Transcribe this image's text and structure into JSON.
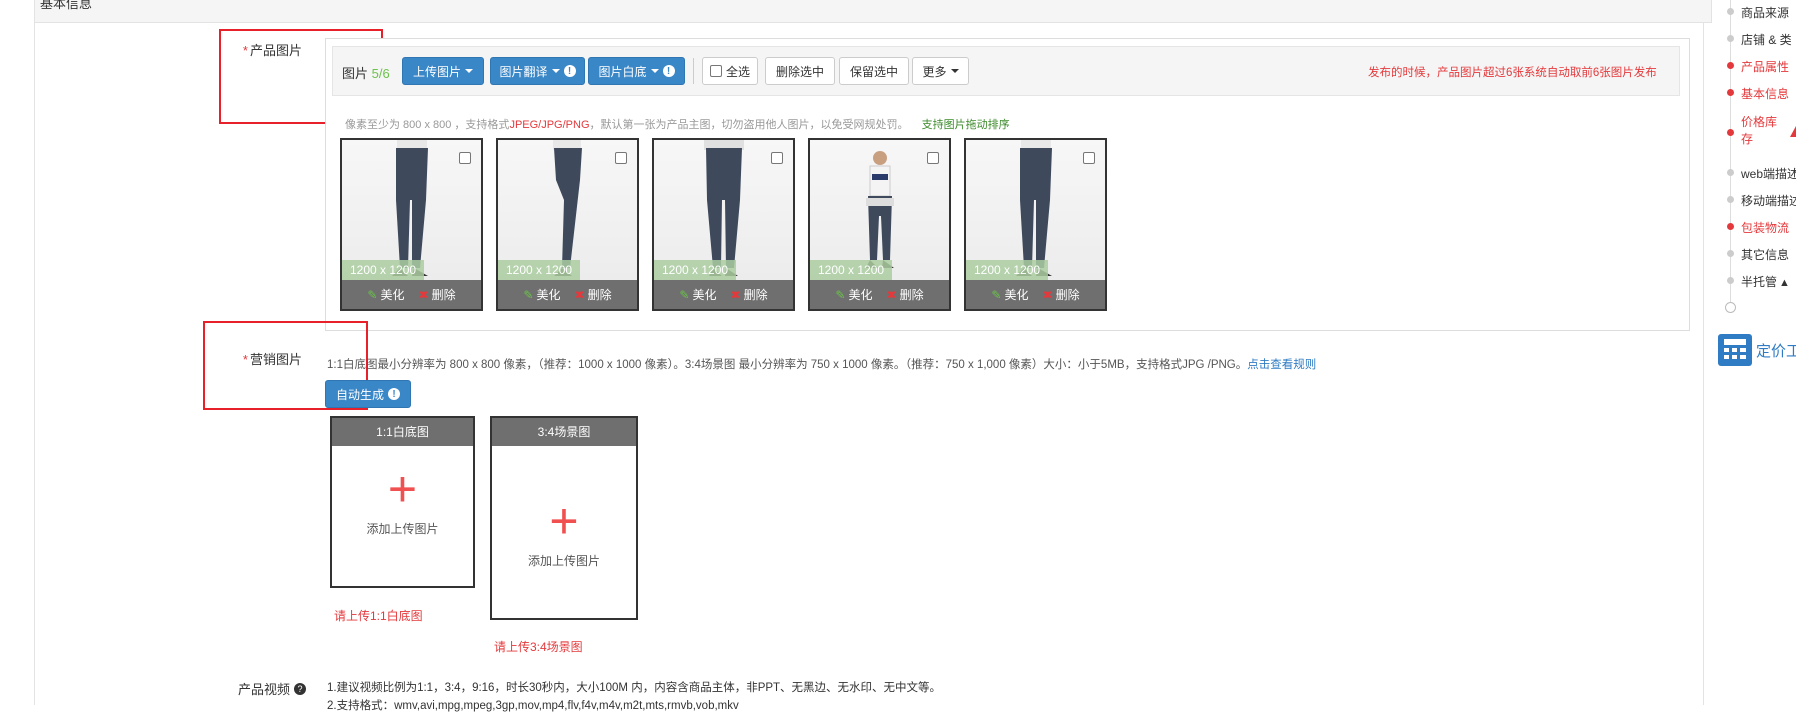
{
  "section": {
    "title": "基本信息"
  },
  "product_images": {
    "label": "产品图片",
    "required_mark": "*",
    "count_label": "图片",
    "count_value": "5/6",
    "buttons": {
      "upload": "上传图片",
      "translate": "图片翻译",
      "white_bg": "图片白底",
      "select_all": "全选",
      "delete_selected": "删除选中",
      "keep_selected": "保留选中",
      "more": "更多"
    },
    "publish_notice": "发布的时候，产品图片超过6张系统自动取前6张图片发布",
    "hint_prefix": "像素至少为 800 x 800 ，支持格式",
    "hint_formats": "JPEG/JPG/PNG",
    "hint_suffix": "，默认第一张为产品主图，切勿盗用他人图片，以免受网规处罚。",
    "hint_sort": "支持图片拖动排序",
    "thumbs": [
      {
        "size": "1200 x 1200",
        "beautify": "美化",
        "delete": "删除"
      },
      {
        "size": "1200 x 1200",
        "beautify": "美化",
        "delete": "删除"
      },
      {
        "size": "1200 x 1200",
        "beautify": "美化",
        "delete": "删除"
      },
      {
        "size": "1200 x 1200",
        "beautify": "美化",
        "delete": "删除"
      },
      {
        "size": "1200 x 1200",
        "beautify": "美化",
        "delete": "删除"
      }
    ]
  },
  "marketing_images": {
    "label": "营销图片",
    "required_mark": "*",
    "rule_text": "1:1白底图最小分辨率为 800 x 800 像素，（推荐：1000 x 1000 像素）。3:4场景图 最小分辨率为 750 x 1000 像素。（推荐：750 x 1,000 像素）大小：小于5MB，支持格式JPG /PNG。",
    "rule_link": "点击查看规则",
    "auto_generate": "自动生成",
    "boxes": [
      {
        "title": "1:1白底图",
        "add_text": "添加上传图片",
        "error": "请上传1:1白底图"
      },
      {
        "title": "3:4场景图",
        "add_text": "添加上传图片",
        "error": "请上传3:4场景图"
      }
    ]
  },
  "product_video": {
    "label": "产品视频",
    "line1": "1.建议视频比例为1:1，3:4，9:16，时长30秒内，大小100M 内，内容含商品主体，非PPT、无黑边、无水印、无中文等。",
    "line2": "2.支持格式：wmv,avi,mpg,mpeg,3gp,mov,mp4,flv,f4v,m4v,m2t,mts,rmvb,vob,mkv"
  },
  "right_nav": {
    "items": [
      {
        "label": "商品来源",
        "status": "normal"
      },
      {
        "label": "店铺 & 类",
        "status": "normal"
      },
      {
        "label": "产品属性",
        "status": "error"
      },
      {
        "label": "基本信息",
        "status": "error"
      },
      {
        "label": "价格库存",
        "status": "error"
      },
      {
        "label": "web端描述",
        "status": "normal"
      },
      {
        "label": "移动端描述",
        "status": "normal"
      },
      {
        "label": "包装物流",
        "status": "error"
      },
      {
        "label": "其它信息",
        "status": "normal"
      },
      {
        "label": "半托管",
        "status": "warning"
      }
    ],
    "pricing_tool": "定价工"
  },
  "colors": {
    "accent": "#3a87c8",
    "error": "#e4393c",
    "annotation": "#e8202a"
  }
}
